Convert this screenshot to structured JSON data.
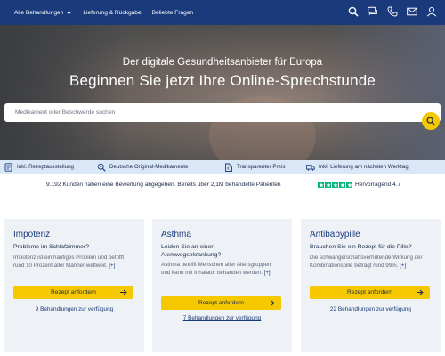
{
  "nav": {
    "links": [
      "Alle Behandlungen",
      "Lieferung & Rückgabe",
      "Beliebte Fragen"
    ],
    "icons": [
      "search-icon",
      "chat-icon",
      "phone-icon",
      "mail-icon",
      "user-icon"
    ],
    "background": "#1a3a7c"
  },
  "hero": {
    "subtitle": "Der digitale Gesundheitsanbieter für Europa",
    "title": "Beginnen Sie jetzt Ihre Online-Sprechstunde",
    "search_placeholder": "Medikament oder Beschwerde suchen",
    "accent": "#f6c800"
  },
  "features": [
    {
      "icon": "prescription-icon",
      "label": "Inkl. Rezeptausstellung"
    },
    {
      "icon": "medicine-search-icon",
      "label": "Deutsche Original-Medikamente"
    },
    {
      "icon": "price-tag-icon",
      "label": "Transparenter Preis"
    },
    {
      "icon": "delivery-truck-icon",
      "label": "Inkl. Lieferung am nächsten Werktag"
    }
  ],
  "reviews": {
    "text": "9.192 Kunden haben eine Bewertung abgegeben. Bereits über 2,1M behandelte Patienten",
    "stars": 5,
    "rating_text": "Hervorragend 4.7",
    "star_color": "#00b67a"
  },
  "cards": [
    {
      "title": "Impotenz",
      "question": "Probleme im Schlafzimmer?",
      "description": "Impotenz ist ein häufiges Problem und betrifft rund 10 Prozent aller Männer weltweit.",
      "more": "[+]",
      "button": "Rezept anfordern",
      "link": "9 Behandlungen zur verfügung"
    },
    {
      "title": "Asthma",
      "question": "Leiden Sie an einer Atemwegsekrankung?",
      "description": "Asthma betrifft Menschen aller Altersgruppen und kann mit Inhalator behandelt werden.",
      "more": "[+]",
      "button": "Rezept anfordern",
      "link": "7 Behandlungen zur verfügung"
    },
    {
      "title": "Antibabypille",
      "question": "Brauchen Sie ein Rezept für die Pille?",
      "description": "Die schwangerschaftsverhütende Wirkung der Kombinationspille beträgt rund 99%.",
      "more": "[+]",
      "button": "Rezept anfordern",
      "link": "22 Behandlungen zur verfügung"
    }
  ]
}
